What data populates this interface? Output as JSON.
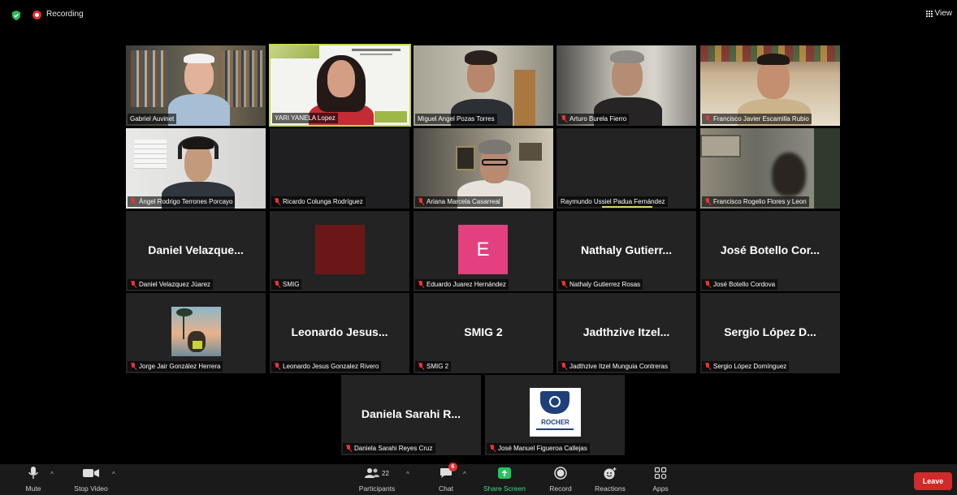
{
  "top_bar": {
    "recording_label": "Recording",
    "view_label": "View"
  },
  "participants": [
    {
      "name": "Gabriel Auvinet",
      "muted": false,
      "video": true
    },
    {
      "name": "YARI YANELA Lopez",
      "muted": false,
      "video": true,
      "active_speaker": true
    },
    {
      "name": "Miguel Angel Pozas Torres",
      "muted": false,
      "video": true
    },
    {
      "name": "Arturo Burela Fierro",
      "muted": true,
      "video": true
    },
    {
      "name": "Francisco Javier Escamilla Rubio",
      "muted": true,
      "video": true
    },
    {
      "name": "Ángel Rodrigo Terrones Porcayo",
      "muted": true,
      "video": true
    },
    {
      "name": "Ricardo Colunga Rodríguez",
      "muted": true,
      "video": true
    },
    {
      "name": "Ariana Marcela Casarreal",
      "muted": true,
      "video": true
    },
    {
      "name": "Raymundo Ussiel Padua Fernández",
      "muted": false,
      "video": true,
      "speaking": true
    },
    {
      "name": "Francisco Rogelio Flores y Leon",
      "muted": true,
      "video": true
    },
    {
      "name": "Daniel Velazquez Júarez",
      "display": "Daniel  Velazque...",
      "muted": true,
      "video": false
    },
    {
      "name": "SMIG",
      "muted": true,
      "video": false
    },
    {
      "name": "Eduardo Juarez Hernández",
      "avatar_letter": "E",
      "muted": true,
      "video": false
    },
    {
      "name": "Nathaly Gutierrez Rosas",
      "display": "Nathaly  Gutierr...",
      "muted": true,
      "video": false
    },
    {
      "name": "José Botello Cordova",
      "display": "José  Botello  Cor...",
      "muted": true,
      "video": false
    },
    {
      "name": "Jorge Jair González Herrera",
      "muted": true,
      "video": false
    },
    {
      "name": "Leonardo Jesus Gonzalez Rivero",
      "display": "Leonardo  Jesus...",
      "muted": true,
      "video": false
    },
    {
      "name": "SMIG 2",
      "display": "SMIG 2",
      "muted": true,
      "video": false
    },
    {
      "name": "Jadthzive Itzel Munguia Contreras",
      "display": "Jadthzive  Itzel...",
      "muted": true,
      "video": false
    },
    {
      "name": "Sergio López Domínguez",
      "display": "Sergio  López  D...",
      "muted": true,
      "video": false
    },
    {
      "name": "Daniela Sarahi Reyes Cruz",
      "display": "Daniela  Sarahi  R...",
      "muted": true,
      "video": false
    },
    {
      "name": "José Manuel Figueroa Callejas",
      "logo_text": "ROCHER",
      "muted": true,
      "video": false
    }
  ],
  "toolbar": {
    "mute": "Mute",
    "stop_video": "Stop Video",
    "participants": "Participants",
    "participants_count": "22",
    "chat": "Chat",
    "chat_badge": "6",
    "share_screen": "Share Screen",
    "record": "Record",
    "reactions": "Reactions",
    "apps": "Apps",
    "leave": "Leave"
  },
  "colors": {
    "accent_green": "#22c55e",
    "leave_red": "#d02a2a",
    "active_speaker_border": "#c5d842",
    "avatar_pink": "#e2407e",
    "avatar_maroon": "#6b1717"
  }
}
